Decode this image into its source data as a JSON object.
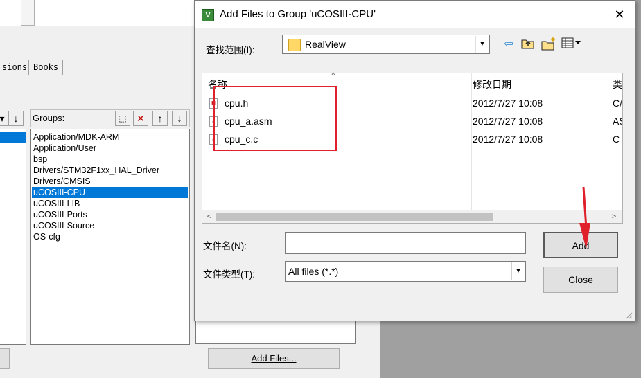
{
  "background_window": {
    "tabs": [
      "sions",
      "Books"
    ],
    "groups_label": "Groups:",
    "groups": [
      "Application/MDK-ARM",
      "Application/User",
      "bsp",
      "Drivers/STM32F1xx_HAL_Driver",
      "Drivers/CMSIS",
      "uCOSIII-CPU",
      "uCOSIII-LIB",
      "uCOSIII-Ports",
      "uCOSIII-Source",
      "OS-cfg"
    ],
    "selected_group": "uCOSIII-CPU",
    "add_files_button": "Add Files..."
  },
  "dialog": {
    "title": "Add Files to Group 'uCOSIII-CPU'",
    "close_glyph": "✕",
    "look_in_label": "查找范围(I):",
    "look_in_value": "RealView",
    "columns": {
      "name": "名称",
      "date": "修改日期",
      "type": "类型"
    },
    "files": [
      {
        "name": "cpu.h",
        "date": "2012/7/27 10:08",
        "type": "C/C",
        "icon": "header-file-icon"
      },
      {
        "name": "cpu_a.asm",
        "date": "2012/7/27 10:08",
        "type": "ASM",
        "icon": "text-file-icon"
      },
      {
        "name": "cpu_c.c",
        "date": "2012/7/27 10:08",
        "type": "C Source",
        "icon": "text-file-icon"
      }
    ],
    "filename_label": "文件名(N):",
    "filename_value": "",
    "filetype_label": "文件类型(T):",
    "filetype_value": "All files (*.*)",
    "add_button": "Add",
    "close_button": "Close"
  },
  "colors": {
    "selection": "#0078d7",
    "annotation": "#e0202a"
  }
}
